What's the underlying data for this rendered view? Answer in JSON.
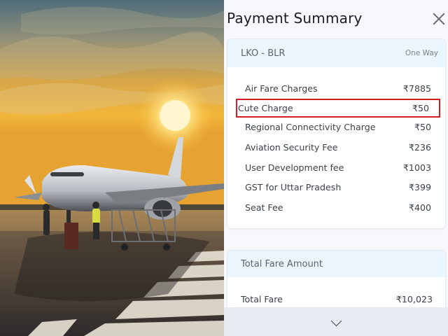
{
  "panel": {
    "title": "Payment Summary",
    "close_icon": "close-icon"
  },
  "route_card": {
    "route": "LKO - BLR",
    "trip_type": "One Way",
    "charges": [
      {
        "label": "Air Fare Charges",
        "amount": "₹7885",
        "highlighted": false
      },
      {
        "label": "Cute Charge",
        "amount": "₹50",
        "highlighted": true
      },
      {
        "label": "Regional Connectivity Charge",
        "amount": "₹50",
        "highlighted": false
      },
      {
        "label": "Aviation Security Fee",
        "amount": "₹236",
        "highlighted": false
      },
      {
        "label": "User Development fee",
        "amount": "₹1003",
        "highlighted": false
      },
      {
        "label": "GST for Uttar Pradesh",
        "amount": "₹399",
        "highlighted": false
      },
      {
        "label": "Seat Fee",
        "amount": "₹400",
        "highlighted": false
      }
    ]
  },
  "total_card": {
    "title": "Total Fare Amount",
    "total_label": "Total Fare",
    "total_value": "₹10,023"
  },
  "bottom_bar": {
    "icon": "chevron-down-icon"
  },
  "colors": {
    "highlight_border": "#d21f26",
    "card_header": "#eaf5fd",
    "bottom_bar": "#e8ebf2"
  }
}
